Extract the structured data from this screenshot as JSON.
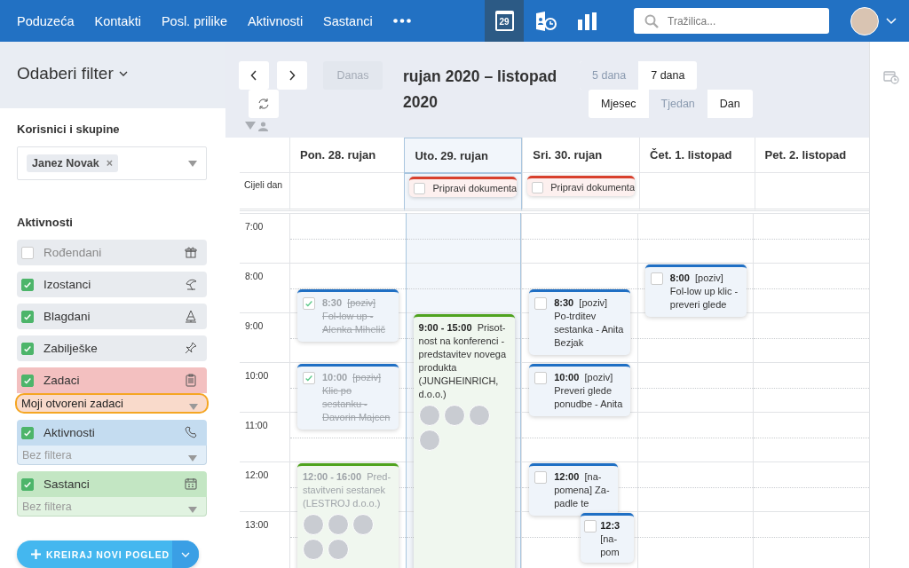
{
  "nav": {
    "menu": [
      {
        "label": "Poduzeća"
      },
      {
        "label": "Kontakti"
      },
      {
        "label": "Posl. prilike"
      },
      {
        "label": "Aktivnosti"
      },
      {
        "label": "Sastanci"
      }
    ],
    "apps": [
      {
        "kind": "calendar",
        "selected": true,
        "day": "29"
      },
      {
        "kind": "activities",
        "selected": false
      },
      {
        "kind": "reports",
        "selected": false
      }
    ],
    "search": {
      "placeholder": "Tražilica..."
    }
  },
  "sidebar": {
    "title": "Odaberi filter",
    "users_label": "Korisnici i skupine",
    "users": [
      {
        "name": "Janez Novak",
        "remove": "×"
      }
    ],
    "activities_label": "Aktivnosti",
    "filters": [
      {
        "kind": "birthdays",
        "label": "Rođendani",
        "checked": false,
        "color": "#e8ebef"
      },
      {
        "kind": "absences",
        "label": "Izostanci",
        "checked": true,
        "color": "#e8ebef"
      },
      {
        "kind": "holidays",
        "label": "Blagdani",
        "checked": true,
        "color": "#e8ebef"
      },
      {
        "kind": "notes",
        "label": "Zabilješke",
        "checked": true,
        "color": "#e8ebef"
      },
      {
        "kind": "tasks",
        "label": "Zadaci",
        "checked": true,
        "color": "#f3c0c0",
        "subfilter": {
          "value": "Moji otvoreni zadaci",
          "focused": true
        }
      },
      {
        "kind": "activities",
        "label": "Aktivnosti",
        "checked": true,
        "color": "#c4dcf0",
        "subfilter": {
          "placeholder": "Bez filtera",
          "focused": false
        }
      },
      {
        "kind": "meetings",
        "label": "Sastanci",
        "checked": true,
        "color": "#c3e6c3",
        "subfilter": {
          "placeholder": "Bez filtera",
          "focused": false
        }
      }
    ],
    "create_button": "KREIRAJ NOVI POGLED"
  },
  "calendar": {
    "toolbar": {
      "today": {
        "label": "Danas",
        "disabled": true
      },
      "title": "rujan 2020 – listopad 2020",
      "day_ranges": [
        {
          "label": "5 dana",
          "selected": true
        },
        {
          "label": "7 dana",
          "selected": false
        }
      ],
      "views": [
        {
          "label": "Mjesec",
          "selected": false
        },
        {
          "label": "Tjedan",
          "selected": true
        },
        {
          "label": "Dan",
          "selected": false
        }
      ]
    },
    "all_day_label": "Cijeli dan",
    "hours": [
      "7:00",
      "8:00",
      "9:00",
      "10:00",
      "11:00",
      "12:00",
      "13:00"
    ],
    "days": [
      {
        "label": "Pon. 28. rujan",
        "selected": false,
        "events": [
          {
            "kind": "task",
            "time": "8:30",
            "text": "[poziv] Fol-low up - Alenka Mihelič",
            "done": true,
            "color": "#1f6fc4"
          },
          {
            "kind": "task",
            "time": "10:00",
            "text": "[poziv] Klic po sestanku - Davorin Majcen",
            "done": true,
            "color": "#1f6fc4"
          },
          {
            "kind": "meeting",
            "time": "12:00 - 16:00",
            "text": "Pred-stavitveni sestanek (LESTROJ d.o.o.)",
            "done": true,
            "color": "#4fa31e"
          }
        ]
      },
      {
        "label": "Uto. 29. rujan",
        "selected": true,
        "all_day": [
          {
            "text": "Pripravi dokumenta",
            "done": false,
            "color": "#d8402d"
          }
        ],
        "events": [
          {
            "kind": "meeting",
            "time": "9:00 - 15:00",
            "text": "Prisot-nost na konferenci - predstavitev novega produkta (JUNGHEINRICH, d.o.o.)",
            "done": false,
            "color": "#4fa31e"
          }
        ]
      },
      {
        "label": "Sri. 30. rujan",
        "selected": false,
        "all_day": [
          {
            "text": "Pripravi dokumenta",
            "done": false,
            "color": "#d8402d"
          }
        ],
        "events": [
          {
            "kind": "task",
            "time": "8:30",
            "text": "[poziv] Po-trditev sestanka - Anita Bezjak",
            "done": false,
            "color": "#1f6fc4"
          },
          {
            "kind": "task",
            "time": "10:00",
            "text": "[poziv] Preveri glede ponudbe - Anita",
            "done": false,
            "color": "#1f6fc4"
          },
          {
            "kind": "task",
            "time": "12:00",
            "text": "[na-pomena] Za-padle te",
            "done": false,
            "color": "#1f6fc4"
          },
          {
            "kind": "task",
            "time": "12:3",
            "text": "[na-pom",
            "done": false,
            "color": "#1f6fc4"
          }
        ]
      },
      {
        "label": "Čet. 1. listopad",
        "selected": false,
        "events": [
          {
            "kind": "task",
            "time": "8:00",
            "text": "[poziv] Fol-low up klic - preveri glede",
            "done": false,
            "color": "#1f6fc4"
          }
        ]
      },
      {
        "label": "Pet. 2. listopad",
        "selected": false
      }
    ]
  }
}
